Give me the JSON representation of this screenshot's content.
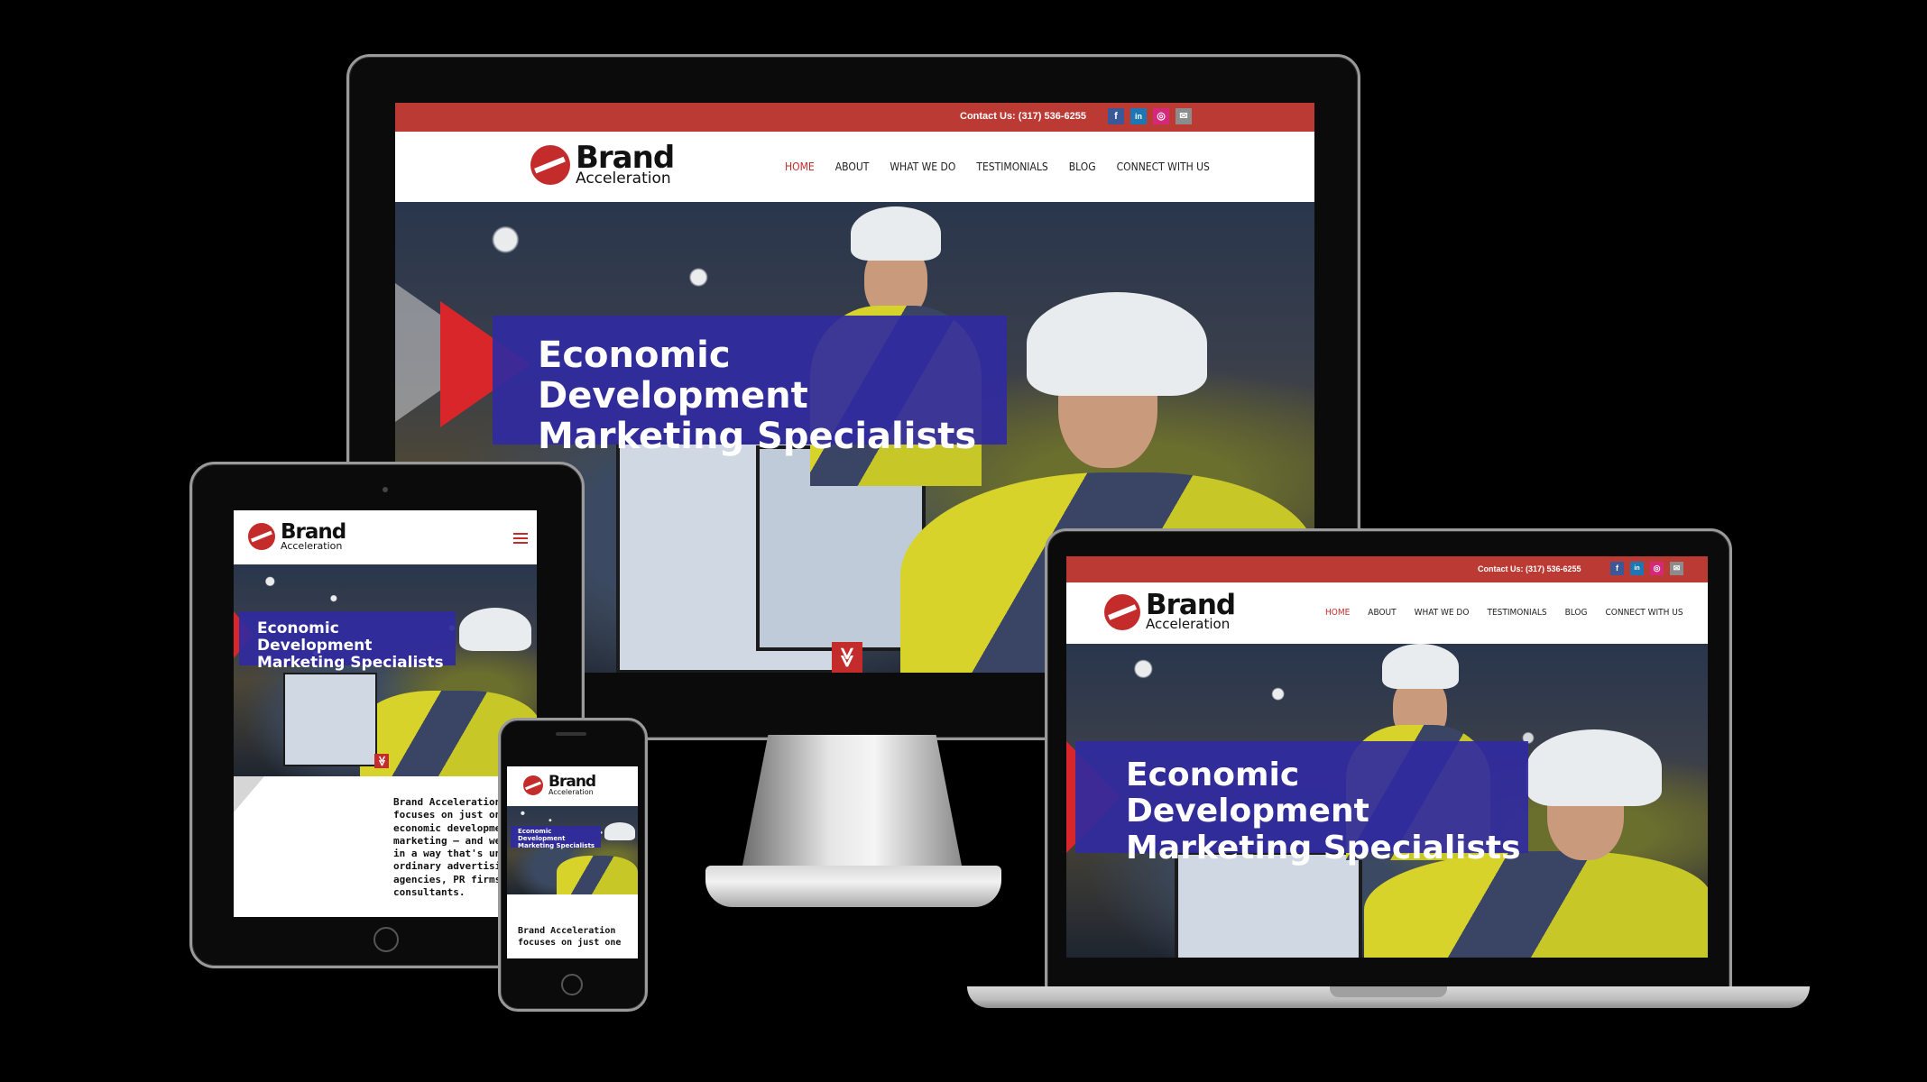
{
  "site": {
    "contact": "Contact Us: (317) 536-6255",
    "social": [
      {
        "icon": "facebook-icon",
        "glyph": "f"
      },
      {
        "icon": "linkedin-icon",
        "glyph": "in"
      },
      {
        "icon": "instagram-icon",
        "glyph": "◎"
      },
      {
        "icon": "email-icon",
        "glyph": "✉"
      }
    ],
    "logo_brand": "Brand",
    "logo_sub": "Acceleration",
    "nav": [
      "HOME",
      "ABOUT",
      "WHAT WE DO",
      "TESTIMONIALS",
      "BLOG",
      "CONNECT WITH US"
    ],
    "nav_active": "HOME",
    "hero_line1": "Economic Development",
    "hero_line2": "Marketing Specialists",
    "down_glyph": "≫",
    "tablet_text": "Brand Acceleration\nfocuses on just one th\neconomic developmen\nmarketing — and we d\nin a way that's unlike\nordinary advertising\nagencies, PR firms, o\nconsultants.",
    "phone_text": "Brand Acceleration\nfocuses on just one"
  },
  "colors": {
    "accent_red": "#bc3a34",
    "banner_blue": "#302aa0",
    "background": "#000000"
  }
}
